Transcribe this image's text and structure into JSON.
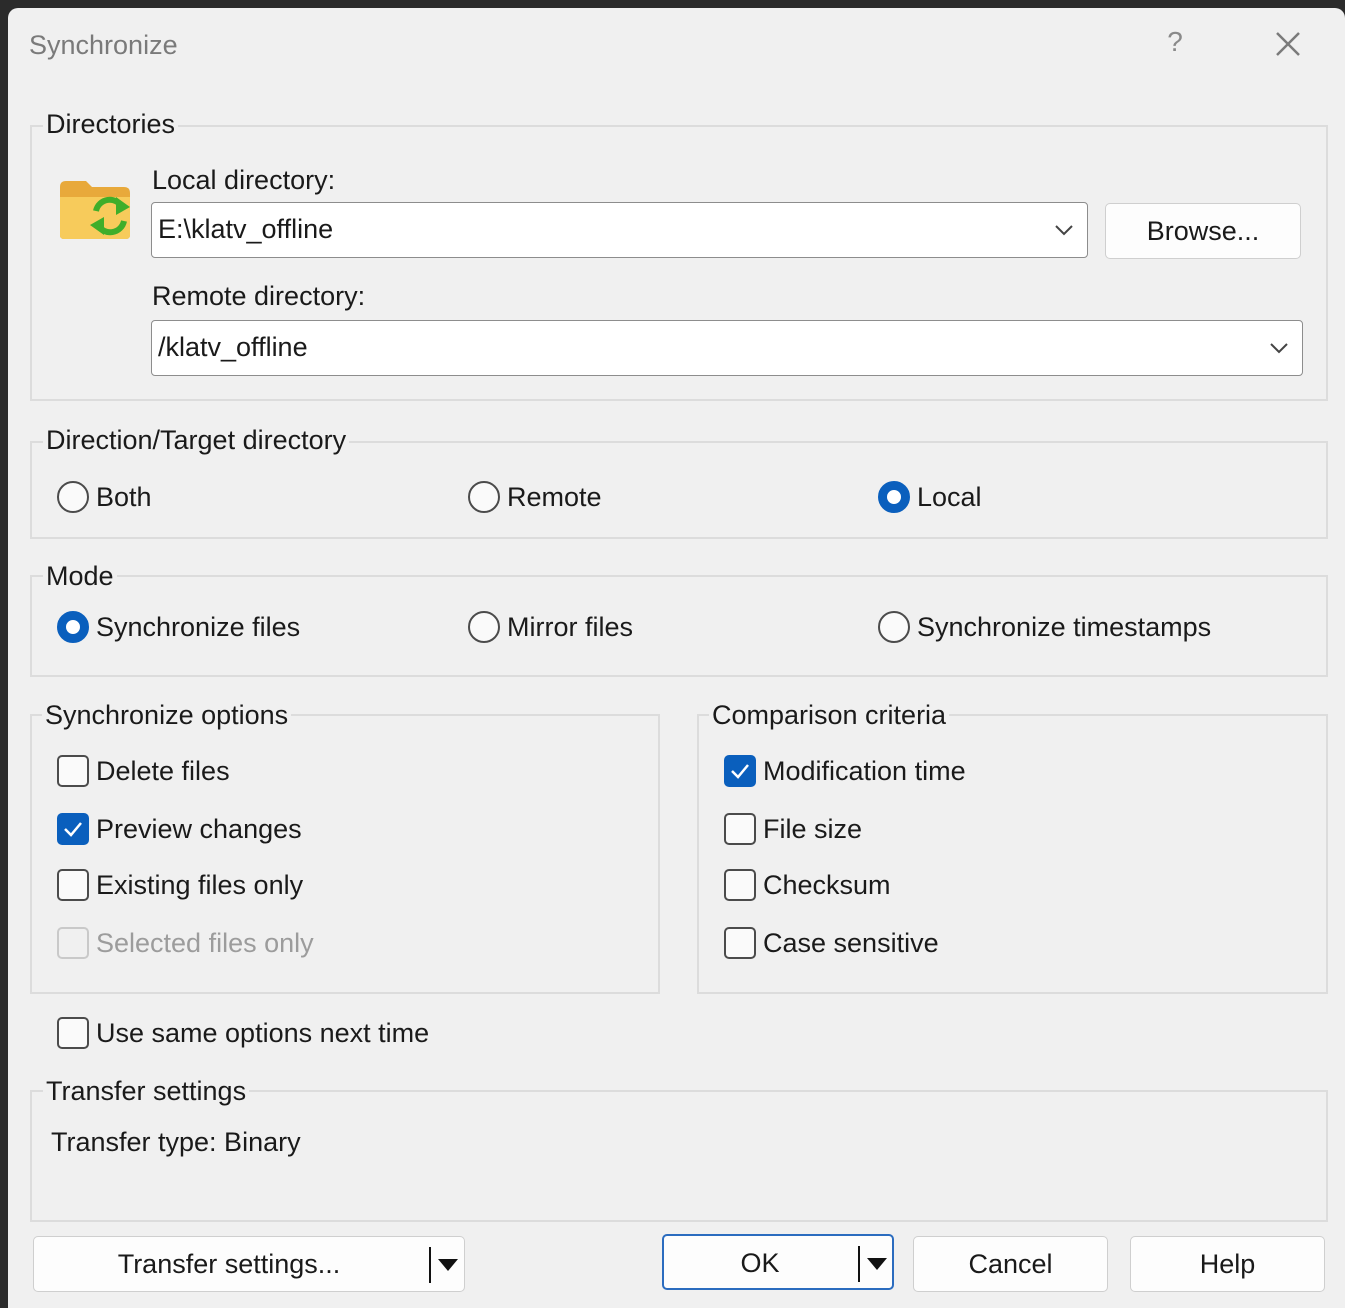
{
  "window": {
    "title": "Synchronize",
    "help_glyph": "?"
  },
  "directories": {
    "group_label": "Directories",
    "local_label": "Local directory:",
    "local_value": "E:\\klatv_offline",
    "browse_label": "Browse...",
    "remote_label": "Remote directory:",
    "remote_value": "/klatv_offline"
  },
  "direction": {
    "group_label": "Direction/Target directory",
    "options": [
      {
        "label": "Both",
        "selected": false
      },
      {
        "label": "Remote",
        "selected": false
      },
      {
        "label": "Local",
        "selected": true
      }
    ]
  },
  "mode": {
    "group_label": "Mode",
    "options": [
      {
        "label": "Synchronize files",
        "selected": true
      },
      {
        "label": "Mirror files",
        "selected": false
      },
      {
        "label": "Synchronize timestamps",
        "selected": false
      }
    ]
  },
  "sync_options": {
    "group_label": "Synchronize options",
    "items": [
      {
        "label": "Delete files",
        "checked": false,
        "enabled": true
      },
      {
        "label": "Preview changes",
        "checked": true,
        "enabled": true
      },
      {
        "label": "Existing files only",
        "checked": false,
        "enabled": true
      },
      {
        "label": "Selected files only",
        "checked": false,
        "enabled": false
      }
    ]
  },
  "comparison": {
    "group_label": "Comparison criteria",
    "items": [
      {
        "label": "Modification time",
        "checked": true
      },
      {
        "label": "File size",
        "checked": false
      },
      {
        "label": "Checksum",
        "checked": false
      },
      {
        "label": "Case sensitive",
        "checked": false
      }
    ]
  },
  "same_options": {
    "label": "Use same options next time",
    "checked": false
  },
  "transfer": {
    "group_label": "Transfer settings",
    "info": "Transfer type: Binary"
  },
  "buttons": {
    "transfer_settings": "Transfer settings...",
    "ok": "OK",
    "cancel": "Cancel",
    "help": "Help"
  },
  "colors": {
    "accent": "#0a5fbd",
    "folder": "#f2c14e",
    "sync_arrows": "#3fae2a"
  },
  "icons": {
    "folder": "folder-sync-icon",
    "close": "close-icon",
    "dropdown": "chevron-down-icon"
  }
}
